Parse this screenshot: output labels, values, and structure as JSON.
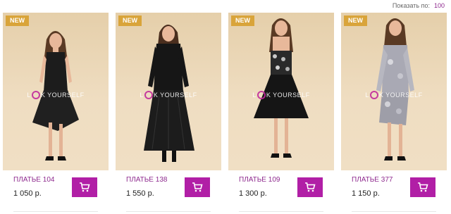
{
  "toolbar": {
    "per_page_label": "Показать по:",
    "per_page_value": "100"
  },
  "colors": {
    "accent": "#b11fa6",
    "name_text": "#8e2a8e",
    "badge": "#d9a43a",
    "photo_bg": "#ead6b4"
  },
  "products": [
    {
      "badge": "NEW",
      "name": "ПЛАТЬЕ 104",
      "price": "1 050 р.",
      "watermark_left": "L",
      "watermark_right": "K YOURSELF"
    },
    {
      "badge": "NEW",
      "name": "ПЛАТЬЕ 138",
      "price": "1 550 р.",
      "watermark_left": "L",
      "watermark_right": "K YOURSELF"
    },
    {
      "badge": "NEW",
      "name": "ПЛАТЬЕ 109",
      "price": "1 300 р.",
      "watermark_left": "L",
      "watermark_right": "K YOURSELF"
    },
    {
      "badge": "NEW",
      "name": "ПЛАТЬЕ 377",
      "price": "1 150 р.",
      "watermark_left": "L",
      "watermark_right": "K YOURSELF"
    }
  ]
}
